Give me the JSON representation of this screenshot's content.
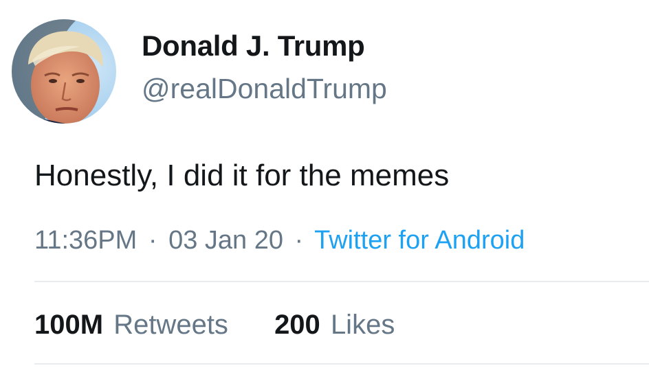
{
  "user": {
    "display_name": "Donald J. Trump",
    "handle": "@realDonaldTrump",
    "avatar_icon": "profile-photo-avatar"
  },
  "tweet": {
    "text": "Honestly, I did it for the memes",
    "time": "11:36PM",
    "separator": "·",
    "date": "03 Jan 20",
    "source": "Twitter for Android"
  },
  "stats": {
    "retweets_count": "100M",
    "retweets_label": "Retweets",
    "likes_count": "200",
    "likes_label": "Likes"
  },
  "colors": {
    "text": "#14171a",
    "secondary": "#657786",
    "link": "#1da1f2",
    "divider": "#e6ecf0"
  }
}
